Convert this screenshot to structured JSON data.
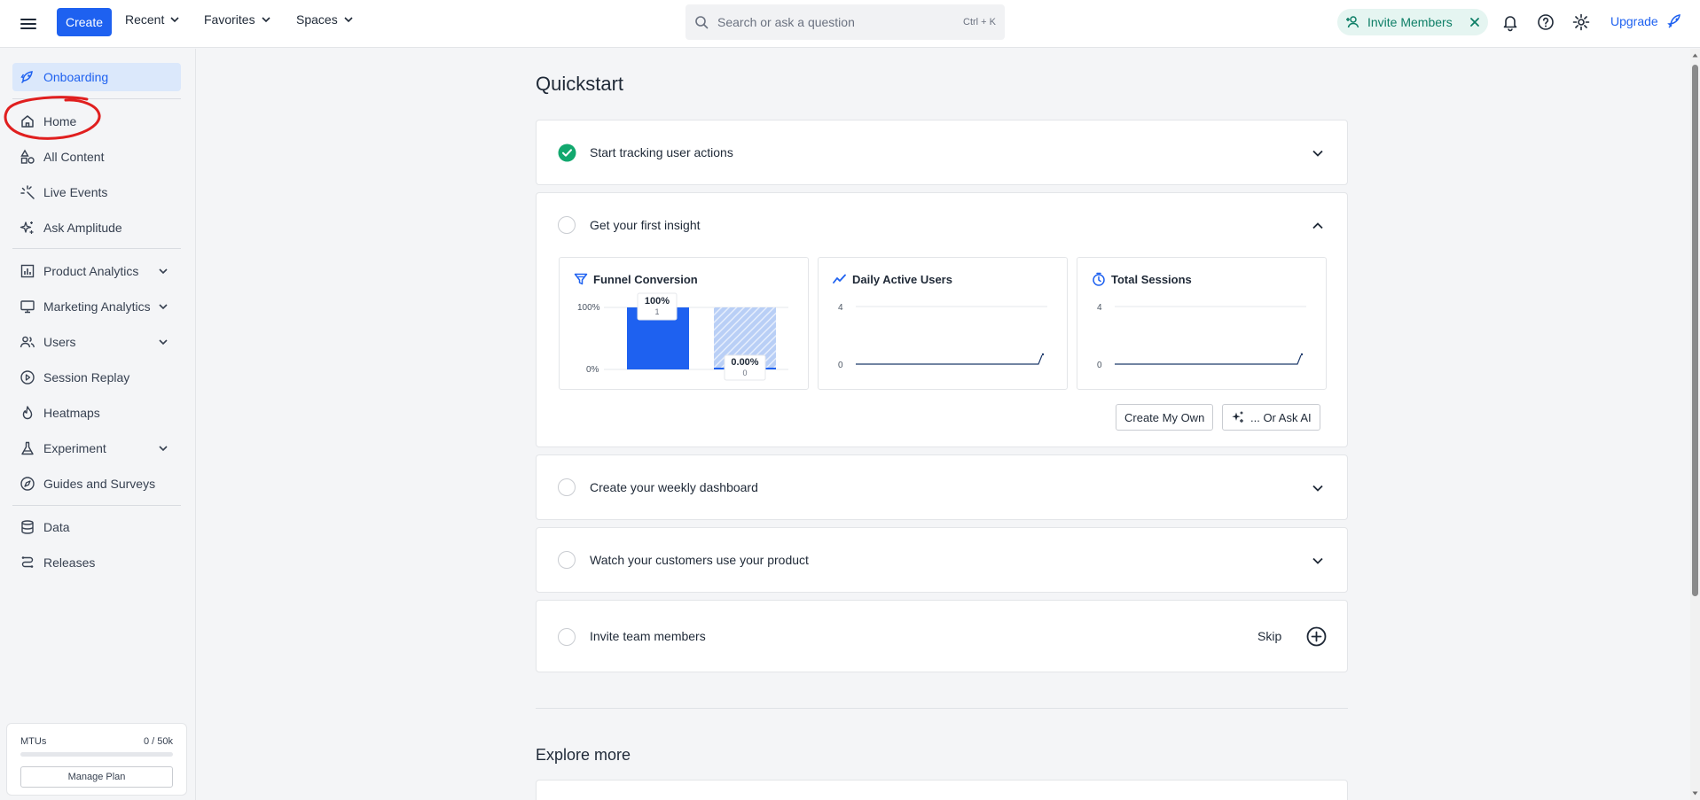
{
  "topbar": {
    "create_label": "Create",
    "nav": [
      {
        "label": "Recent"
      },
      {
        "label": "Favorites"
      },
      {
        "label": "Spaces"
      }
    ],
    "search_placeholder": "Search or ask a question",
    "search_shortcut": "Ctrl + K",
    "invite_label": "Invite Members",
    "upgrade_label": "Upgrade"
  },
  "sidebar": {
    "items": [
      {
        "label": "Onboarding",
        "icon": "rocket-icon"
      },
      {
        "label": "Home",
        "icon": "home-icon"
      },
      {
        "label": "All Content",
        "icon": "shapes-icon"
      },
      {
        "label": "Live Events",
        "icon": "sparkle-burst-icon"
      },
      {
        "label": "Ask Amplitude",
        "icon": "ai-sparkle-icon"
      },
      {
        "label": "Product Analytics",
        "icon": "bar-chart-icon"
      },
      {
        "label": "Marketing Analytics",
        "icon": "monitor-icon"
      },
      {
        "label": "Users",
        "icon": "users-icon"
      },
      {
        "label": "Session Replay",
        "icon": "play-circle-icon"
      },
      {
        "label": "Heatmaps",
        "icon": "flame-icon"
      },
      {
        "label": "Experiment",
        "icon": "flask-icon"
      },
      {
        "label": "Guides and Surveys",
        "icon": "compass-icon"
      },
      {
        "label": "Data",
        "icon": "database-icon"
      },
      {
        "label": "Releases",
        "icon": "releases-icon"
      }
    ],
    "mtus": {
      "label": "MTUs",
      "value": "0 / 50k",
      "usage_fraction": 0,
      "button": "Manage Plan"
    }
  },
  "main": {
    "title": "Quickstart",
    "steps": [
      {
        "label": "Start tracking user actions",
        "status": "complete"
      },
      {
        "label": "Get your first insight",
        "status": "expanded"
      },
      {
        "label": "Create your weekly dashboard",
        "status": "incomplete"
      },
      {
        "label": "Watch your customers use your product",
        "status": "incomplete"
      },
      {
        "label": "Invite team members",
        "status": "incomplete",
        "action": "Skip"
      }
    ],
    "insight_cards": [
      {
        "title": "Funnel Conversion",
        "icon": "funnel-icon",
        "y_ticks": [
          "100%",
          "0%"
        ],
        "bars": [
          {
            "percent": "100%",
            "count": "1"
          },
          {
            "percent": "0.00%",
            "count": "0"
          }
        ]
      },
      {
        "title": "Daily Active Users",
        "icon": "line-chart-icon",
        "y_ticks": [
          "4",
          "0"
        ]
      },
      {
        "title": "Total Sessions",
        "icon": "stopwatch-icon",
        "y_ticks": [
          "4",
          "0"
        ]
      }
    ],
    "create_own_label": "Create My Own",
    "ask_ai_label": "... Or Ask AI",
    "explore_title": "Explore more"
  },
  "colors": {
    "brand": "#1e61f0",
    "success": "#12a86e",
    "invite_bg": "#e5f5f1",
    "annotation": "#e01f1f"
  }
}
